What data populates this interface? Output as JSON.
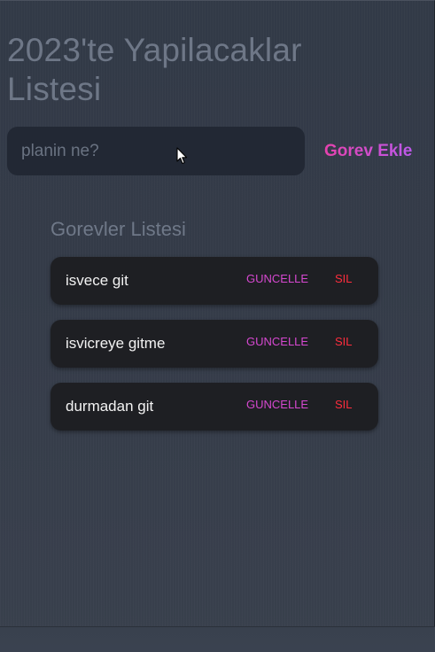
{
  "app": {
    "title": "2023'te Yapilacaklar Listesi"
  },
  "form": {
    "input_placeholder": "planin ne?",
    "input_value": "",
    "add_label": "Gorev Ekle"
  },
  "list": {
    "title": "Gorevler Listesi",
    "items": [
      {
        "text": "isvece git",
        "edit_label": "GUNCELLE",
        "delete_label": "SIL"
      },
      {
        "text": "isvicreye gitme",
        "edit_label": "GUNCELLE",
        "delete_label": "SIL"
      },
      {
        "text": "durmadan git",
        "edit_label": "GUNCELLE",
        "delete_label": "SIL"
      }
    ]
  },
  "colors": {
    "background": "#323a47",
    "card": "#1e1f23",
    "accent_start": "#ea3fa6",
    "accent_end": "#b85cf2",
    "edit": "#d648d0",
    "delete": "#ff2d3d"
  },
  "icons": {
    "cursor": "mouse-pointer-icon"
  }
}
